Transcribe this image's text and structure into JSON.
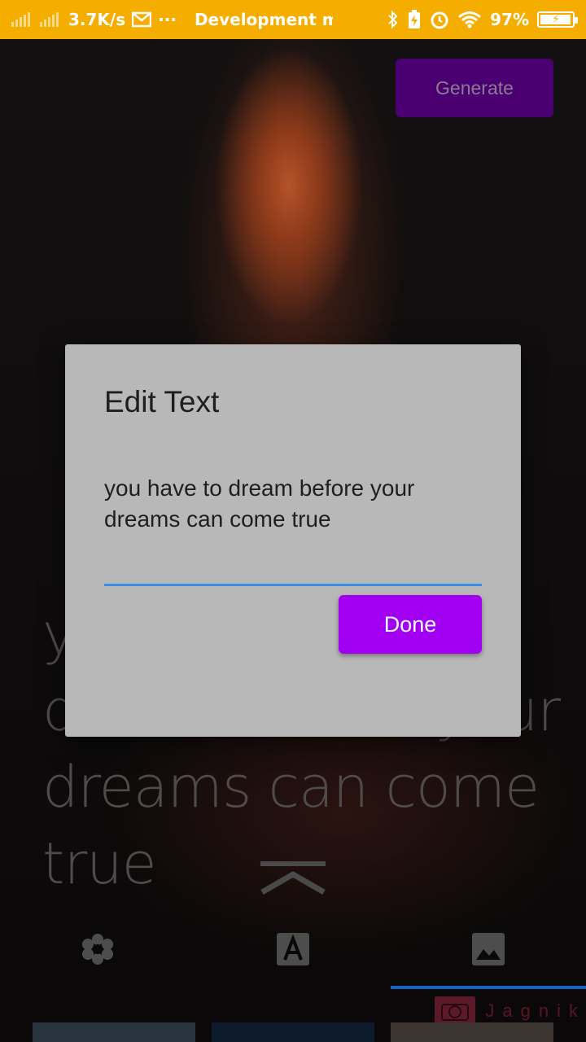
{
  "status_bar": {
    "network_speed": "3.7K/s",
    "more": "···",
    "notification_title": "Development m",
    "battery_percent": "97%",
    "background_color": "#f5ad00"
  },
  "header": {
    "generate_label": "Generate",
    "generate_color": "#4a0070"
  },
  "quote": {
    "text": "you have to dream before your dreams can come true"
  },
  "dialog": {
    "title": "Edit Text",
    "text_value": "you have to dream before your dreams can come true",
    "done_label": "Done",
    "done_color": "#a100f2",
    "underline_color": "#3d8fe6"
  },
  "bottom_nav": {
    "items": [
      {
        "icon": "flower-icon"
      },
      {
        "icon": "text-format-icon"
      },
      {
        "icon": "image-icon",
        "selected": true
      }
    ],
    "indicator_color": "#1565c0"
  },
  "watermark": {
    "text": "Jagnik"
  }
}
